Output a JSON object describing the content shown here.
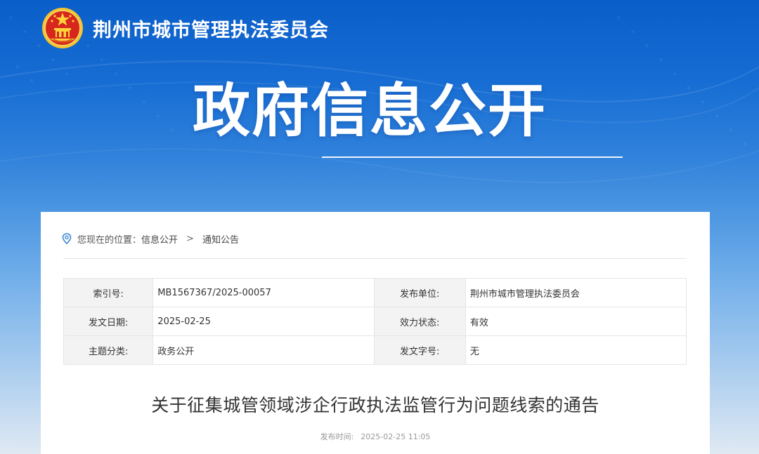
{
  "header": {
    "site_title": "荆州市城市管理执法委员会"
  },
  "banner": {
    "title": "政府信息公开"
  },
  "breadcrumb": {
    "prefix": "您现在的位置：",
    "items": [
      "信息公开",
      "通知公告"
    ],
    "separator": ">"
  },
  "meta": {
    "rows": [
      [
        {
          "label": "索引号:",
          "value": "MB1567367/2025-00057"
        },
        {
          "label": "发布单位:",
          "value": "荆州市城市管理执法委员会"
        }
      ],
      [
        {
          "label": "发文日期:",
          "value": "2025-02-25"
        },
        {
          "label": "效力状态:",
          "value": "有效"
        }
      ],
      [
        {
          "label": "主题分类:",
          "value": "政务公开"
        },
        {
          "label": "发文字号:",
          "value": "无"
        }
      ]
    ]
  },
  "article": {
    "title": "关于征集城管领域涉企行政执法监管行为问题线索的通告",
    "publish_label": "发布时间:",
    "publish_time": "2025-02-25 11:05"
  },
  "colors": {
    "banner_blue": "#0a5ec9",
    "emblem_red": "#d7261e",
    "emblem_gold": "#f2c230",
    "pin_blue": "#3a87d6"
  },
  "icons": {
    "emblem": "national-emblem-icon",
    "location": "location-pin-icon"
  }
}
